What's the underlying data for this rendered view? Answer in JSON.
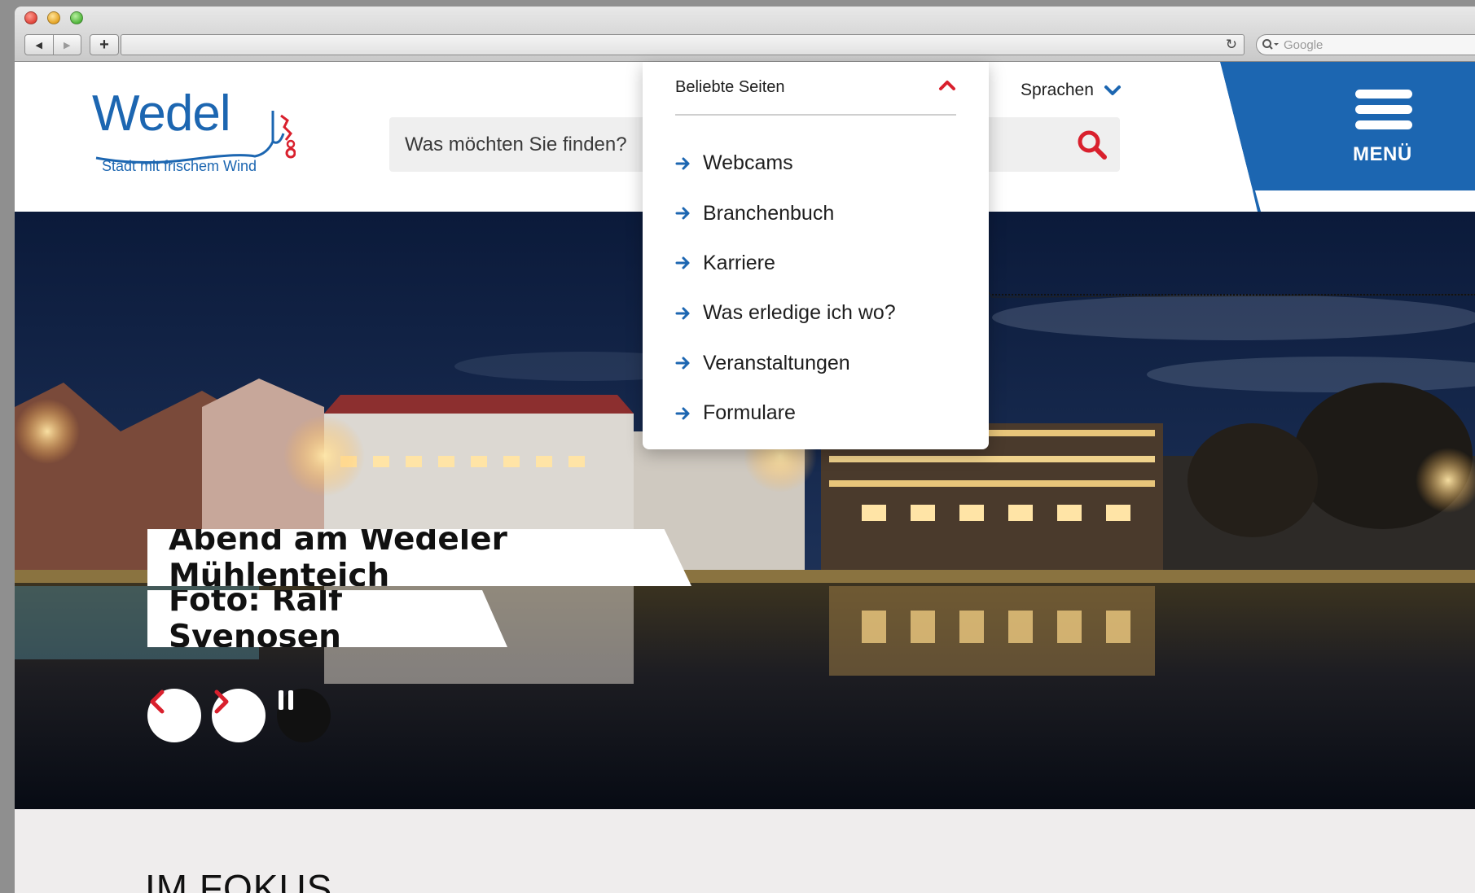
{
  "browser": {
    "back_symbol": "◀",
    "forward_symbol": "▶",
    "new_tab_symbol": "+",
    "search_placeholder": "Google"
  },
  "header": {
    "logo_word": "Wedel",
    "logo_tagline": "Stadt mit frischem Wind",
    "search_placeholder": "Was möchten Sie finden?",
    "languages_label": "Sprachen",
    "menu_label": "MENÜ"
  },
  "popular_pages": {
    "title": "Beliebte Seiten",
    "items": [
      {
        "label": "Webcams"
      },
      {
        "label": "Branchenbuch"
      },
      {
        "label": "Karriere"
      },
      {
        "label": "Was erledige ich wo?"
      },
      {
        "label": "Veranstaltungen"
      },
      {
        "label": "Formulare"
      }
    ]
  },
  "hero": {
    "caption_title": "Abend am Wedeler Mühlenteich",
    "caption_credit": "Foto: Ralf Svenosen"
  },
  "section": {
    "heading": "IM FOKUS"
  },
  "colors": {
    "brand_blue": "#1c66b1",
    "accent_red": "#d9202d",
    "link_arrow": "#1c66b1"
  }
}
